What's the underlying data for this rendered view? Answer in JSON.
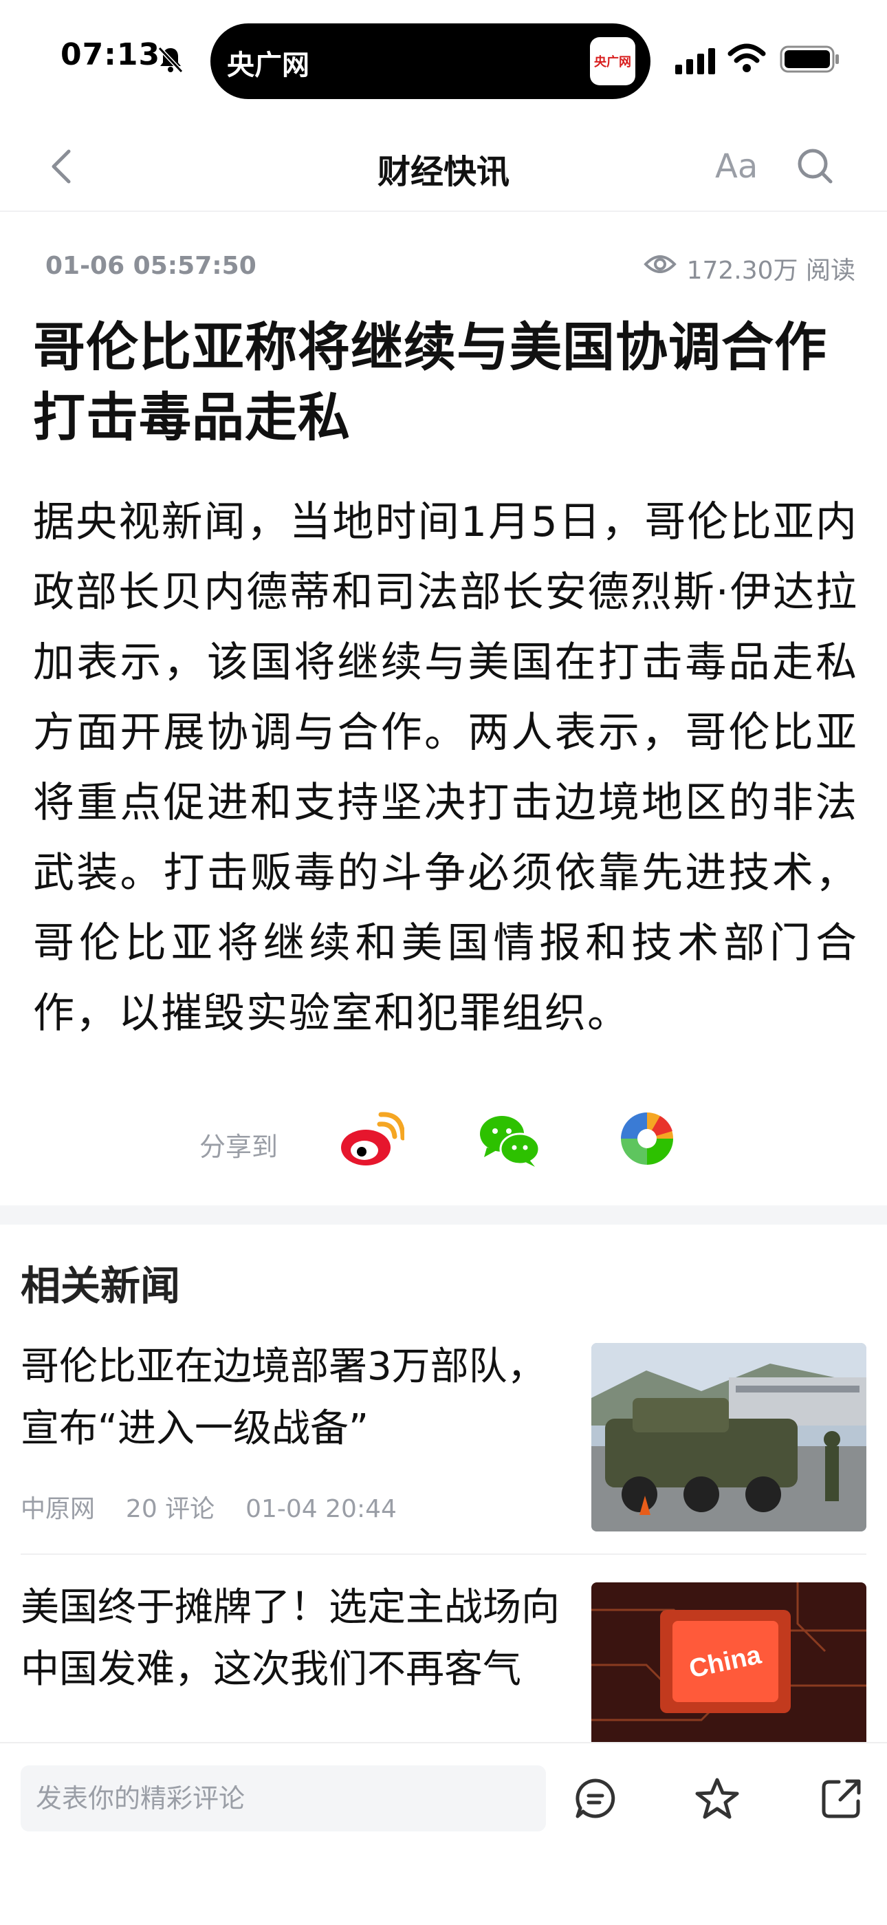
{
  "status_bar": {
    "time": "07:13",
    "island_label": "央广网",
    "island_logo_text": "央广网"
  },
  "nav": {
    "title": "财经快讯",
    "font_button": "Aa"
  },
  "article": {
    "date": "01-06 05:57:50",
    "views": "172.30万 阅读",
    "title": "哥伦比亚称将继续与美国协调合作打击毒品走私",
    "body": "据央视新闻，当地时间1月5日，哥伦比亚内政部长贝内德蒂和司法部长安德烈斯·伊达拉加表示，该国将继续与美国在打击毒品走私方面开展协调与合作。两人表示，哥伦比亚将重点促进和支持坚决打击边境地区的非法武装。打击贩毒的斗争必须依靠先进技术，哥伦比亚将继续和美国情报和技术部门合作，以摧毁实验室和犯罪组织。"
  },
  "share": {
    "label": "分享到",
    "targets": [
      "weibo-icon",
      "wechat-icon",
      "moments-icon"
    ]
  },
  "related": {
    "heading": "相关新闻",
    "items": [
      {
        "title": "哥伦比亚在边境部署3万部队，宣布“进入一级战备”",
        "source": "中原网",
        "comments": "20 评论",
        "time": "01-04 20:44"
      },
      {
        "title": "美国终于摊牌了！选定主战场向中国发难，这次我们不再客气",
        "thumb_text": "China"
      }
    ]
  },
  "bottom_bar": {
    "comment_placeholder": "发表你的精彩评论",
    "icons": [
      "comment-icon",
      "star-icon",
      "share-icon"
    ]
  },
  "colors": {
    "text": "#111111",
    "muted": "#9a9ea6",
    "weibo_red": "#e6162d",
    "wechat_green": "#2dc100"
  }
}
